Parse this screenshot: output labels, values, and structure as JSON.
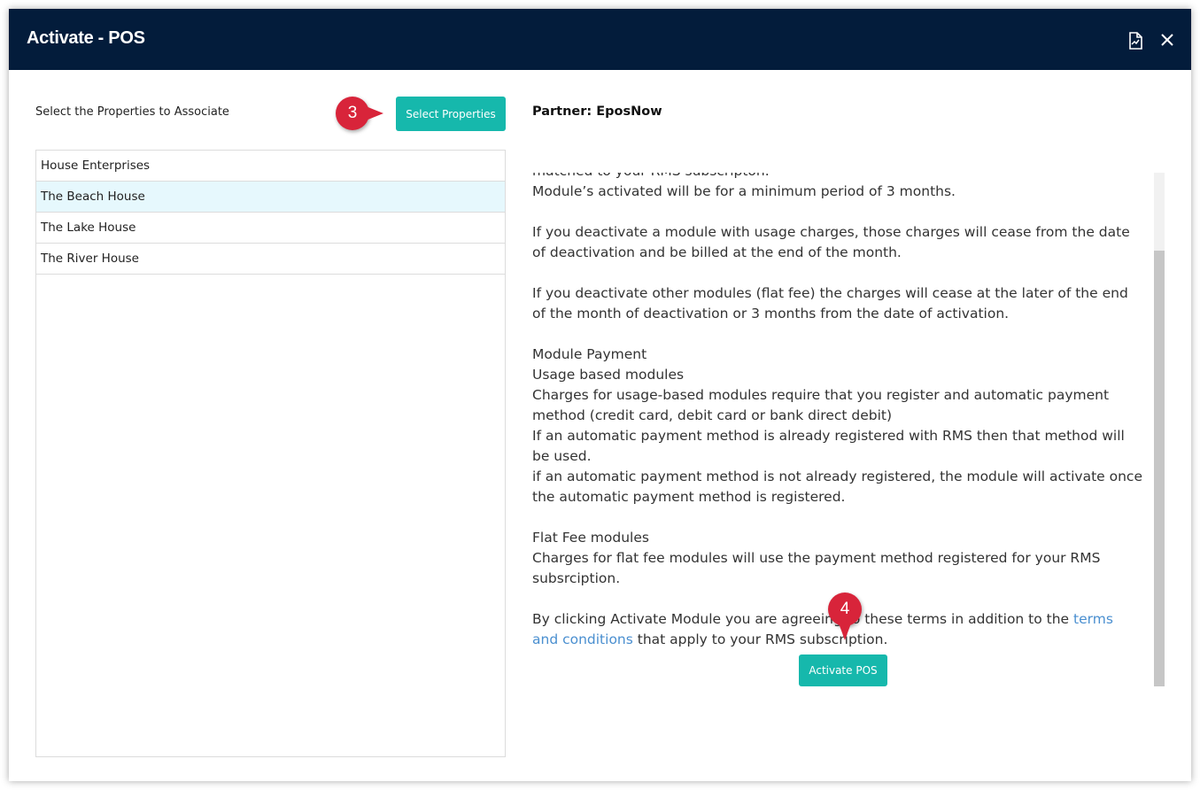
{
  "dialog": {
    "title": "Activate - POS",
    "icons": {
      "report": "document-chart-icon",
      "close": "close-icon"
    }
  },
  "left": {
    "label": "Select the Properties to Associate",
    "select_button": "Select Properties",
    "properties": [
      "House Enterprises",
      "The Beach House",
      "The Lake House",
      "The River House"
    ],
    "selected": "The Beach House"
  },
  "right": {
    "partner": "Partner: EposNow",
    "terms": {
      "line_cut": "matched to your RMS subscripton.",
      "p1": "Module’s activated will be for a minimum period of 3 months.",
      "p2": "If you deactivate a module with usage charges, those charges will cease from the date of deactivation and be billed at the end of the month.",
      "p3": "If you deactivate other modules (flat fee) the charges will cease at the later of the end of the month of deactivation or 3 months from the date of activation.",
      "payment_heading": "Module Payment",
      "usage_heading": "Usage based modules",
      "usage_1": "Charges for usage-based modules require that you register and automatic payment method (credit card, debit card or bank direct debit)",
      "usage_2": "If an automatic payment method is already registered with RMS then that method will be used.",
      "usage_3": "if an automatic payment method is not already registered, the module will activate once the automatic payment method is registered.",
      "flat_heading": "Flat Fee modules",
      "flat_1": "Charges for flat fee modules will use the payment method registered for your RMS subsrciption.",
      "agree_pre": "By clicking Activate Module you are agreeing to these terms in addition to the",
      "agree_link": "terms and conditions",
      "agree_post": "that apply to your RMS subscription."
    },
    "activate_button": "Activate POS"
  },
  "annotations": {
    "step3": "3",
    "step4": "4"
  },
  "colors": {
    "header": "#031c3b",
    "button": "#16b8ac",
    "badge": "#d8243a",
    "link": "#4a8fd0",
    "selected_row": "#e6f8fd"
  }
}
